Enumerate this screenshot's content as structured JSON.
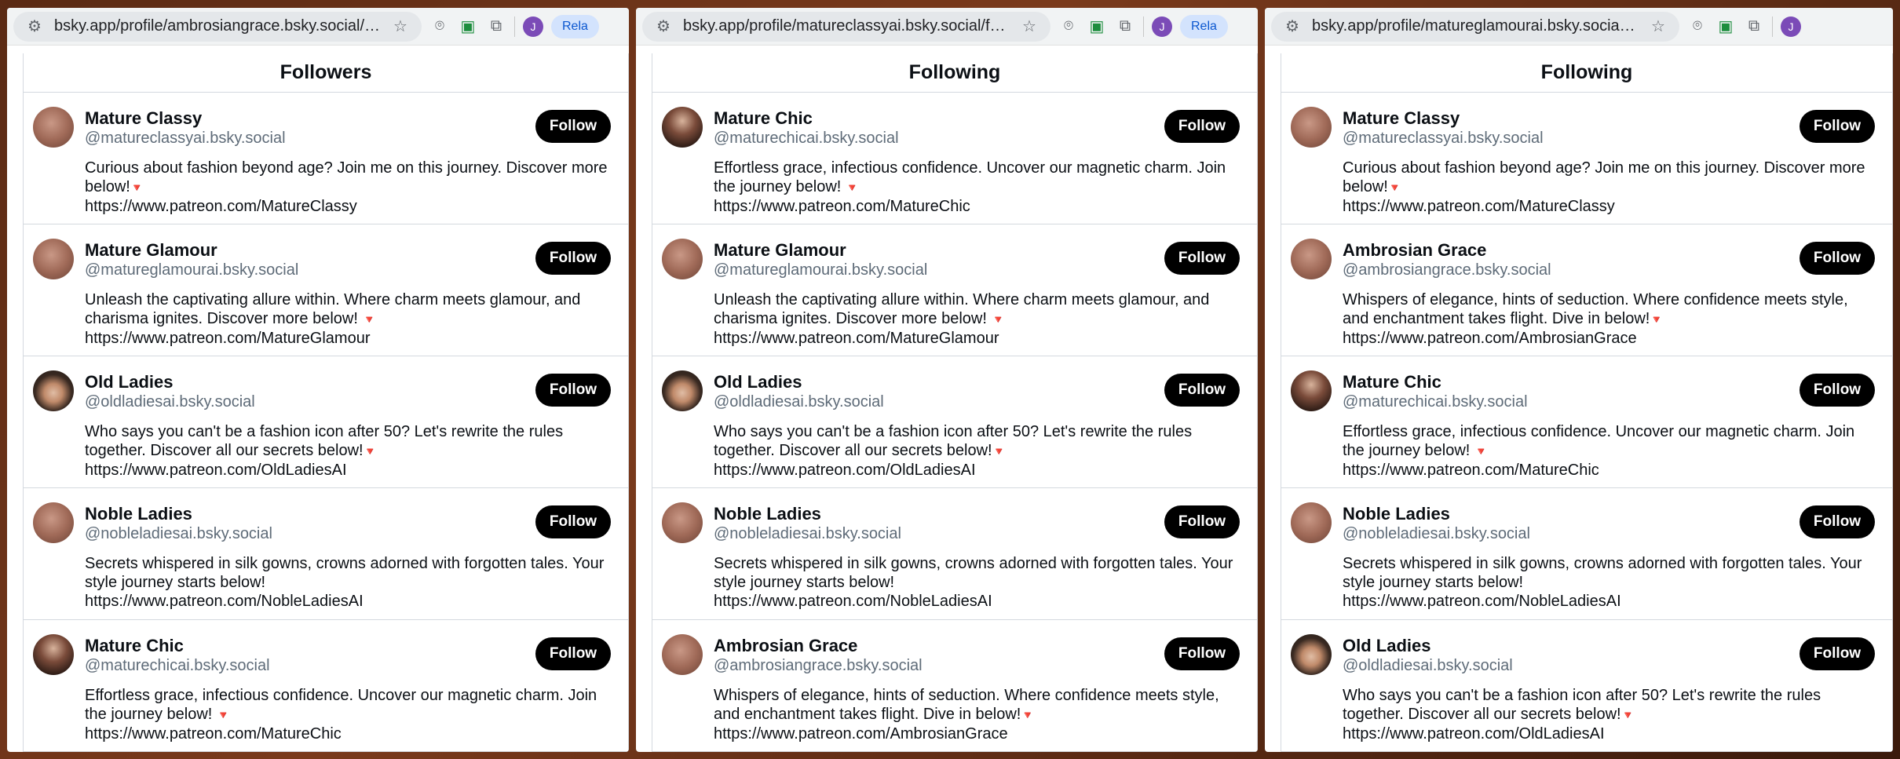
{
  "windows": [
    {
      "url": "bsky.app/profile/ambrosiangrace.bsky.social/fol...",
      "avatar_letter": "J",
      "relaunch": "Rela",
      "heading": "Followers",
      "users": [
        {
          "name": "Mature Classy",
          "handle": "@matureclassyai.bsky.social",
          "bio1": "Curious about fashion beyond age? Join me on this journey. Discover more below!",
          "link": "https://www.patreon.com/MatureClassy",
          "follow": "Follow",
          "pic": "blur"
        },
        {
          "name": "Mature Glamour",
          "handle": "@matureglamourai.bsky.social",
          "bio1": "Unleash the captivating allure within. Where charm meets glamour, and charisma ignites. Discover more below! ",
          "link": "https://www.patreon.com/MatureGlamour",
          "follow": "Follow",
          "pic": "blur"
        },
        {
          "name": "Old Ladies",
          "handle": "@oldladiesai.bsky.social",
          "bio1": "Who says you can't be a fashion icon after 50? Let's rewrite the rules together. Discover all our secrets below!",
          "link": "https://www.patreon.com/OldLadiesAI",
          "follow": "Follow",
          "pic": "hat"
        },
        {
          "name": "Noble Ladies",
          "handle": "@nobleladiesai.bsky.social",
          "bio1": "Secrets whispered in silk gowns, crowns adorned with forgotten tales. Your style journey starts below!",
          "link": "https://www.patreon.com/NobleLadiesAI",
          "follow": "Follow",
          "pic": "blur",
          "no_tri": true
        },
        {
          "name": "Mature Chic",
          "handle": "@maturechicai.bsky.social",
          "bio1": "Effortless grace, infectious confidence. Uncover our magnetic charm. Join the journey below! ",
          "link": "https://www.patreon.com/MatureChic",
          "follow": "Follow",
          "pic": "sharp"
        }
      ]
    },
    {
      "url": "bsky.app/profile/matureclassyai.bsky.social/foll...",
      "avatar_letter": "J",
      "relaunch": "Rela",
      "heading": "Following",
      "users": [
        {
          "name": "Mature Chic",
          "handle": "@maturechicai.bsky.social",
          "bio1": "Effortless grace, infectious confidence. Uncover our magnetic charm. Join the journey below! ",
          "link": "https://www.patreon.com/MatureChic",
          "follow": "Follow",
          "pic": "sharp"
        },
        {
          "name": "Mature Glamour",
          "handle": "@matureglamourai.bsky.social",
          "bio1": "Unleash the captivating allure within. Where charm meets glamour, and charisma ignites. Discover more below! ",
          "link": "https://www.patreon.com/MatureGlamour",
          "follow": "Follow",
          "pic": "blur"
        },
        {
          "name": "Old Ladies",
          "handle": "@oldladiesai.bsky.social",
          "bio1": "Who says you can't be a fashion icon after 50? Let's rewrite the rules together. Discover all our secrets below!",
          "link": "https://www.patreon.com/OldLadiesAI",
          "follow": "Follow",
          "pic": "hat"
        },
        {
          "name": "Noble Ladies",
          "handle": "@nobleladiesai.bsky.social",
          "bio1": "Secrets whispered in silk gowns, crowns adorned with forgotten tales. Your style journey starts below!",
          "link": "https://www.patreon.com/NobleLadiesAI",
          "follow": "Follow",
          "pic": "blur",
          "no_tri": true
        },
        {
          "name": "Ambrosian Grace",
          "handle": "@ambrosiangrace.bsky.social",
          "bio1": "Whispers of elegance, hints of seduction. Where confidence meets style, and enchantment takes flight. Dive in below!",
          "link": "https://www.patreon.com/AmbrosianGrace",
          "follow": "Follow",
          "pic": "blur"
        }
      ]
    },
    {
      "url": "bsky.app/profile/matureglamourai.bsky.social/f...",
      "avatar_letter": "J",
      "relaunch": "",
      "heading": "Following",
      "users": [
        {
          "name": "Mature Classy",
          "handle": "@matureclassyai.bsky.social",
          "bio1": "Curious about fashion beyond age? Join me on this journey. Discover more below!",
          "link": "https://www.patreon.com/MatureClassy",
          "follow": "Follow",
          "pic": "blur"
        },
        {
          "name": "Ambrosian Grace",
          "handle": "@ambrosiangrace.bsky.social",
          "bio1": "Whispers of elegance, hints of seduction. Where confidence meets style, and enchantment takes flight. Dive in below!",
          "link": "https://www.patreon.com/AmbrosianGrace",
          "follow": "Follow",
          "pic": "blur"
        },
        {
          "name": "Mature Chic",
          "handle": "@maturechicai.bsky.social",
          "bio1": "Effortless grace, infectious confidence. Uncover our magnetic charm. Join the journey below! ",
          "link": "https://www.patreon.com/MatureChic",
          "follow": "Follow",
          "pic": "sharp"
        },
        {
          "name": "Noble Ladies",
          "handle": "@nobleladiesai.bsky.social",
          "bio1": "Secrets whispered in silk gowns, crowns adorned with forgotten tales. Your style journey starts below!",
          "link": "https://www.patreon.com/NobleLadiesAI",
          "follow": "Follow",
          "pic": "blur",
          "no_tri": true
        },
        {
          "name": "Old Ladies",
          "handle": "@oldladiesai.bsky.social",
          "bio1": "Who says you can't be a fashion icon after 50? Let's rewrite the rules together. Discover all our secrets below!",
          "link": "https://www.patreon.com/OldLadiesAI",
          "follow": "Follow",
          "pic": "hat"
        }
      ]
    }
  ]
}
